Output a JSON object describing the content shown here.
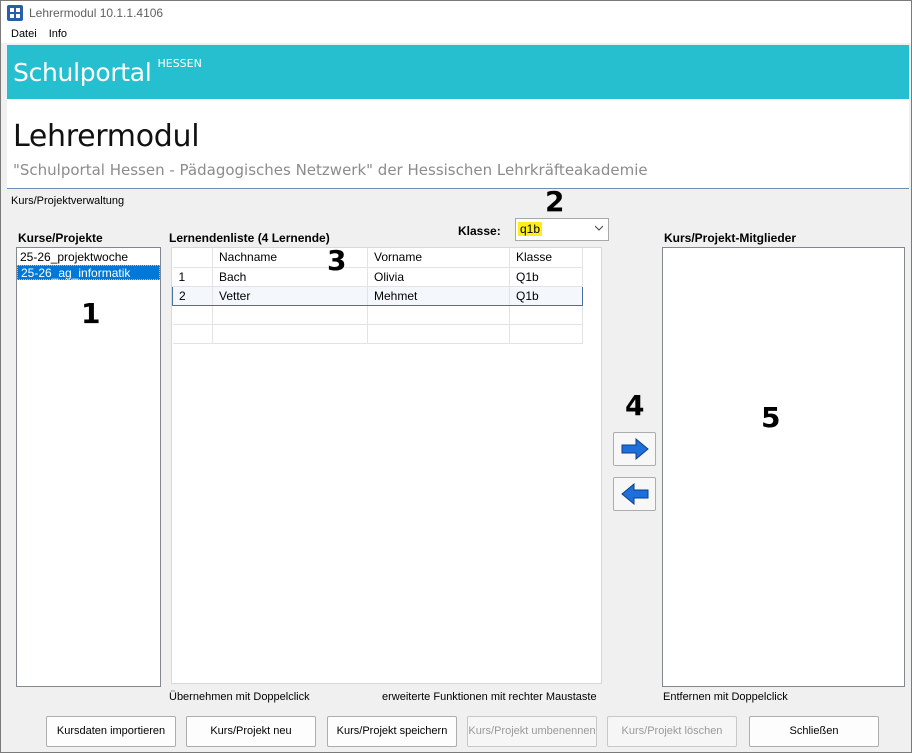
{
  "window": {
    "title": "Lehrermodul 10.1.1.4106"
  },
  "menu": [
    "Datei",
    "Info"
  ],
  "banner": {
    "title": "Schulportal",
    "sup": "HESSEN"
  },
  "header": {
    "title": "Lehrermodul",
    "subtitle": "\"Schulportal Hessen - Pädagogisches Netzwerk\" der Hessischen Lehrkräfteakademie"
  },
  "section_label": "Kurs/Projektverwaltung",
  "courses": {
    "label": "Kurse/Projekte",
    "items": [
      {
        "name": "25-26_projektwoche",
        "selected": false
      },
      {
        "name": "25-26_ag_informatik",
        "selected": true
      }
    ]
  },
  "students": {
    "label": "Lernendenliste (4 Lernende)",
    "columns": [
      "",
      "Nachname",
      "Vorname",
      "Klasse"
    ],
    "rows": [
      [
        "1",
        "Bach",
        "Olivia",
        "Q1b"
      ],
      [
        "2",
        "Vetter",
        "Mehmet",
        "Q1b"
      ]
    ],
    "selected_row": 1,
    "hint_left": "Übernehmen mit Doppelclick",
    "hint_right": "erweiterte Funktionen mit rechter Maustaste"
  },
  "klasse": {
    "label": "Klasse:",
    "value": "q1b"
  },
  "members": {
    "label": "Kurs/Projekt-Mitglieder",
    "hint": "Entfernen mit Doppelclick"
  },
  "markers": [
    "1",
    "2",
    "3",
    "4",
    "5"
  ],
  "icons": {
    "add": "arrow-right-icon",
    "remove": "arrow-left-icon"
  },
  "colors": {
    "banner": "#25bfcf",
    "selection": "#0078d7",
    "highlight": "#ffee1a",
    "arrow": "#1e6fd9"
  },
  "buttons": {
    "import": {
      "label": "Kursdaten importieren",
      "enabled": true
    },
    "new": {
      "label": "Kurs/Projekt neu",
      "enabled": true
    },
    "save": {
      "label": "Kurs/Projekt speichern",
      "enabled": true
    },
    "rename": {
      "label": "Kurs/Projekt umbenennen",
      "enabled": false
    },
    "delete": {
      "label": "Kurs/Projekt löschen",
      "enabled": false
    },
    "close": {
      "label": "Schließen",
      "enabled": true
    }
  }
}
